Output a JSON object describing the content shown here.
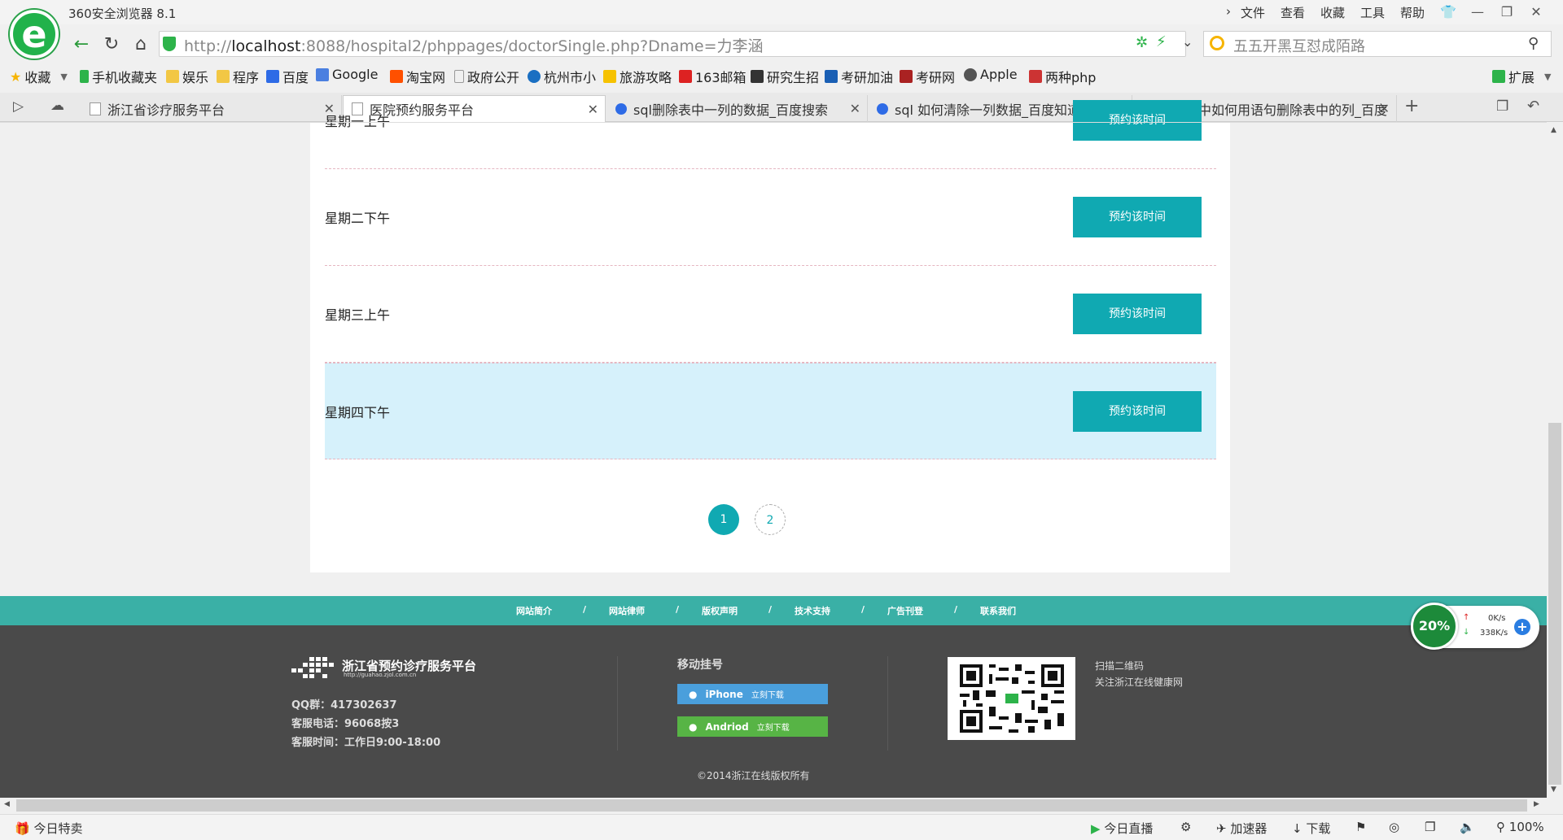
{
  "window": {
    "app_name": "360安全浏览器 8.1",
    "menus": [
      "文件",
      "查看",
      "收藏",
      "工具",
      "帮助"
    ]
  },
  "address_bar": {
    "url_prefix": "http://",
    "url_host": "localhost",
    "url_rest": ":8088/hospital2/phppages/doctorSingle.php?Dname=力李涵",
    "search_placeholder": "五五开黑互怼成陌路"
  },
  "bookmarks": [
    {
      "label": "收藏",
      "icon": "star-icon",
      "color": "#f6b400"
    },
    {
      "label": "手机收藏夹",
      "icon": "phone-icon",
      "color": "#2db34a"
    },
    {
      "label": "娱乐",
      "icon": "folder-icon",
      "color": "#f2c744"
    },
    {
      "label": "程序",
      "icon": "folder-icon",
      "color": "#f2c744"
    },
    {
      "label": "百度",
      "icon": "baidu-icon",
      "color": "#2e6be6"
    },
    {
      "label": "Google",
      "icon": "google-icon",
      "color": "#4a7fe0"
    },
    {
      "label": "淘宝网",
      "icon": "taobao-icon",
      "color": "#ff5000"
    },
    {
      "label": "政府公开",
      "icon": "page-icon",
      "color": "#cccccc"
    },
    {
      "label": "杭州市小",
      "icon": "hangzhou-icon",
      "color": "#1a6fc2"
    },
    {
      "label": "旅游攻略",
      "icon": "mafengwo-icon",
      "color": "#f6c200"
    },
    {
      "label": "163邮箱",
      "icon": "mail163-icon",
      "color": "#d22"
    },
    {
      "label": "研究生招",
      "icon": "graduate-icon",
      "color": "#333"
    },
    {
      "label": "考研加油",
      "icon": "kaoyan-icon",
      "color": "#1a5fb4"
    },
    {
      "label": "考研网",
      "icon": "book-icon",
      "color": "#a22"
    },
    {
      "label": "Apple",
      "icon": "apple-icon",
      "color": "#555"
    },
    {
      "label": "两种php",
      "icon": "php-icon",
      "color": "#c33"
    }
  ],
  "extensions_label": "扩展",
  "tabs": [
    {
      "title": "浙江省诊疗服务平台",
      "icon": "page-icon"
    },
    {
      "title": "医院预约服务平台",
      "icon": "page-icon",
      "active": true
    },
    {
      "title": "sql删除表中一列的数据_百度搜索",
      "icon": "baidu-icon"
    },
    {
      "title": "sql 如何清除一列数据_百度知道",
      "icon": "baidu-icon"
    },
    {
      "title": "数据库中如何用语句删除表中的列_百度",
      "icon": "baidu-icon"
    }
  ],
  "schedule": {
    "rows": [
      {
        "label": "星期一上午",
        "button": "预约该时间"
      },
      {
        "label": "星期二下午",
        "button": "预约该时间"
      },
      {
        "label": "星期三上午",
        "button": "预约该时间"
      },
      {
        "label": "星期四下午",
        "button": "预约该时间",
        "highlighted": true
      }
    ],
    "pages": [
      "1",
      "2"
    ],
    "current_page": 1
  },
  "footer": {
    "nav": [
      "网站简介",
      "网站律师",
      "版权声明",
      "技术支持",
      "广告刊登",
      "联系我们"
    ],
    "separator": "/",
    "logo_text": "浙江省预约诊疗服务平台",
    "logo_sub": "http://guahao.zjol.com.cn",
    "qq": "QQ群：417302637",
    "phone": "客服电话：96068按3",
    "hours": "客服时间：工作日9:00-18:00",
    "mobile_title": "移动挂号",
    "iphone_label": "iPhone",
    "android_label": "Andriod",
    "download_label": "立刻下载",
    "qr_line1": "扫描二维码",
    "qr_line2": "关注浙江在线健康网",
    "copyright": "©2014浙江在线版权所有"
  },
  "speed_widget": {
    "percent": "20%",
    "upload": "0K/s",
    "download": "338K/s"
  },
  "status_bar": {
    "left": "今日特卖",
    "items": [
      "今日直播",
      "加速器",
      "下载"
    ],
    "zoom": "100%"
  },
  "colors": {
    "accent": "#10a9b2",
    "footer_nav": "#3ab0a6",
    "footer": "#4a4a4a",
    "highlight_row": "#d6f1fb"
  }
}
